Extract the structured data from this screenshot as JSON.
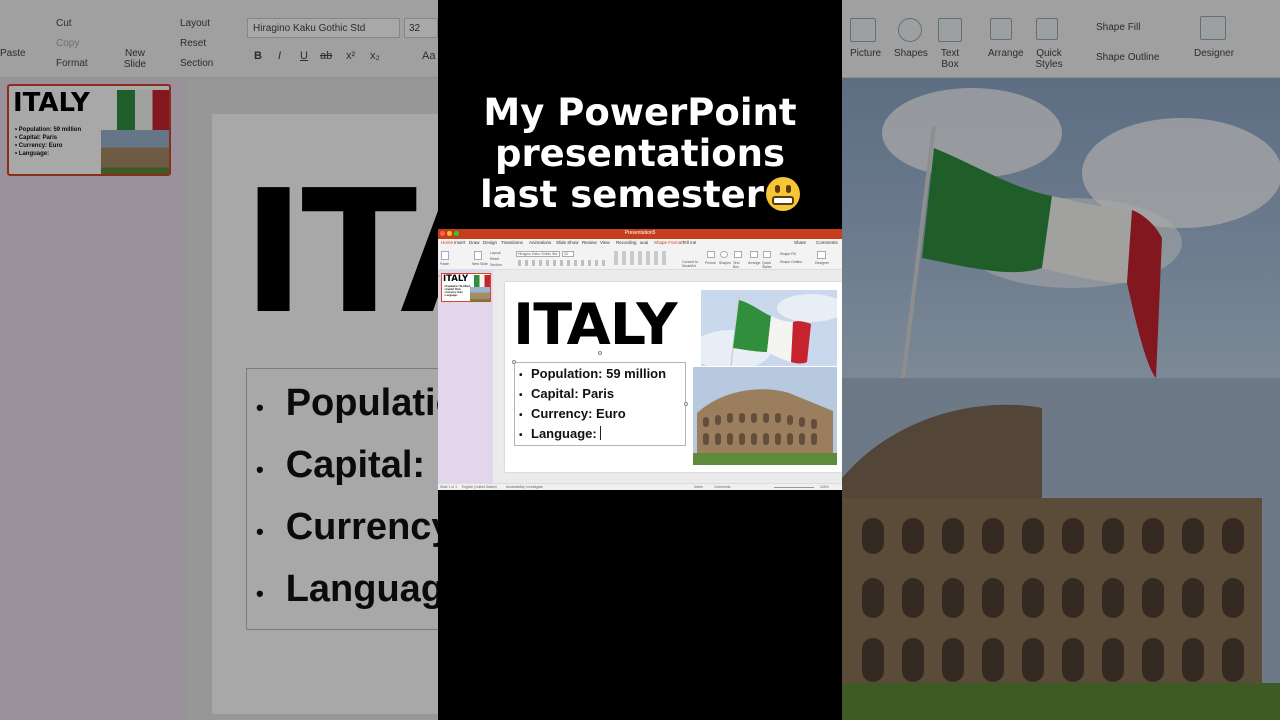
{
  "caption": {
    "line1": "My PowerPoint",
    "line2": "presentations",
    "line3": "last semester",
    "emoji": "grimacing-face-emoji"
  },
  "background_ribbon": {
    "clipboard": [
      "Cut",
      "Copy",
      "Format"
    ],
    "paste": "Paste",
    "new_slide": "New Slide",
    "slide_items": [
      "Layout",
      "Reset",
      "Section"
    ],
    "font_name": "Hiragino Kaku Gothic Std",
    "font_size": "32",
    "format_buttons": [
      "B",
      "I",
      "U",
      "ab",
      "x²",
      "x₂",
      "Aa"
    ],
    "insert_items": [
      "Picture",
      "Shapes",
      "Text Box"
    ],
    "arrange": "Arrange",
    "quick_styles": "Quick Styles",
    "shape_fill": "Shape Fill",
    "shape_outline": "Shape Outline",
    "designer": "Designer",
    "share": "Share",
    "comments": "Comments"
  },
  "ppt": {
    "window_title": "Presentation5",
    "tabs": [
      "Home",
      "Insert",
      "Draw",
      "Design",
      "Transitions",
      "Animations",
      "Slide Show",
      "Review",
      "View",
      "Recording",
      "acai",
      "Shape Format",
      "Tell me"
    ],
    "share": "Share",
    "comments": "Comments",
    "ribbon": {
      "paste": "Paste",
      "new_slide": "New Slide",
      "layout": "Layout",
      "reset": "Reset",
      "section": "Section",
      "font_name": "Hiragino Kaku Gothic Std",
      "font_size": "32",
      "convert": "Convert to SmartArt",
      "picture": "Picture",
      "shapes": "Shapes",
      "text_box": "Text Box",
      "arrange": "Arrange",
      "quick_styles": "Quick Styles",
      "shape_fill": "Shape Fill",
      "shape_outline": "Shape Outline",
      "designer": "Designer"
    },
    "thumb_number": "1",
    "slide": {
      "title": "ITALY",
      "bullets": [
        "Population: 59 million",
        "Capital: Paris",
        "Currency: Euro",
        "Language:"
      ]
    },
    "status": {
      "slide_info": "Slide 1 of 1",
      "language": "English (United States)",
      "accessibility": "Accessibility: Investigate",
      "notes": "Notes",
      "comments": "Comments",
      "zoom": "115%"
    }
  },
  "colors": {
    "ppt_accent": "#c43e1c",
    "flag_green": "#2f8f3d",
    "flag_white": "#f4f4f1",
    "flag_red": "#c6232f"
  }
}
